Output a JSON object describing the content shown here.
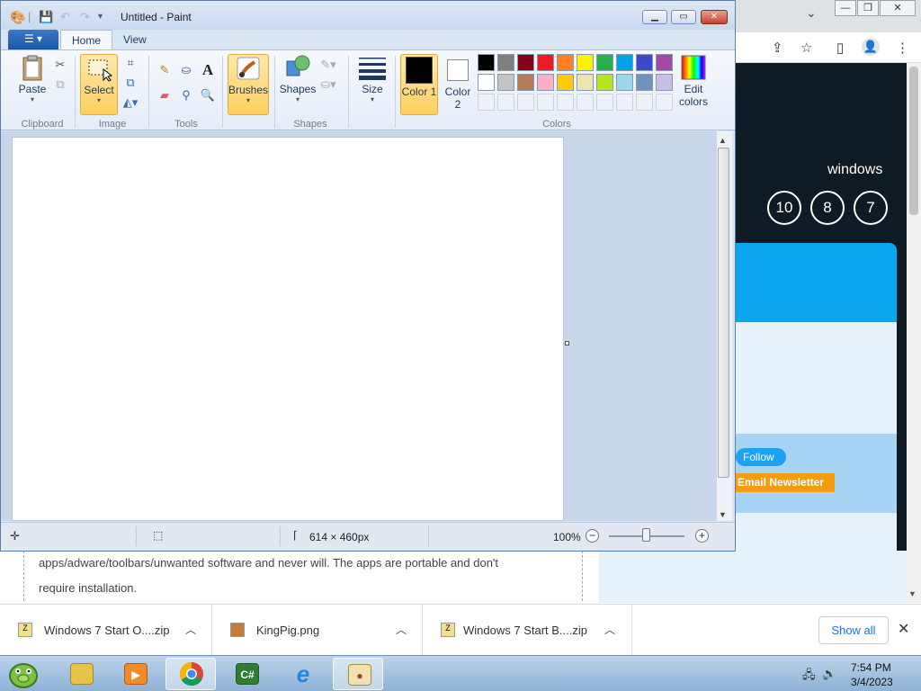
{
  "paint": {
    "title": "Untitled - Paint",
    "tabs": [
      "Home",
      "View"
    ],
    "groups": {
      "clipboard": "Clipboard",
      "image": "Image",
      "tools": "Tools",
      "shapes": "Shapes",
      "colors": "Colors"
    },
    "buttons": {
      "paste": "Paste",
      "select": "Select",
      "brushes": "Brushes",
      "shapes": "Shapes",
      "size": "Size",
      "color1": "Color 1",
      "color2": "Color 2",
      "edit_colors": "Edit colors"
    },
    "color1_value": "#000000",
    "color2_value": "#ffffff",
    "palette_row1": [
      "#000000",
      "#7f7f7f",
      "#880015",
      "#ed1c24",
      "#ff7f27",
      "#fff200",
      "#22b14c",
      "#00a2e8",
      "#3f48cc",
      "#a349a4"
    ],
    "palette_row2": [
      "#ffffff",
      "#c3c3c3",
      "#b97a57",
      "#ffaec9",
      "#ffc90e",
      "#efe4b0",
      "#b5e61d",
      "#99d9ea",
      "#7092be",
      "#c8bfe7"
    ],
    "status": {
      "image_size": "614 × 460px",
      "zoom": "100%"
    }
  },
  "browser": {
    "site_label": "windows",
    "versions": [
      "10",
      "8",
      "7"
    ],
    "follow": "Follow",
    "newsletter": "Email Newsletter",
    "content_lines": [
      "apps/adware/toolbars/unwanted software and never will. The apps are portable and don't",
      "require installation."
    ]
  },
  "downloads": {
    "items": [
      "Windows 7 Start O....zip",
      "KingPig.png",
      "Windows 7 Start B....zip"
    ],
    "show_all": "Show all"
  },
  "taskbar": {
    "time": "7:54 PM",
    "date": "3/4/2023"
  }
}
